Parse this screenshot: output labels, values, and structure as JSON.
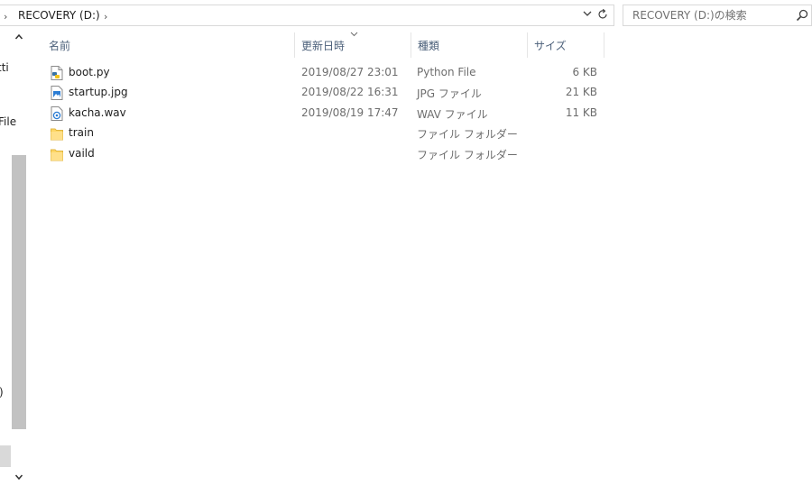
{
  "address_bar": {
    "path_label": "RECOVERY (D:)",
    "separator": "›",
    "dropdown_glyph": "⌄",
    "refresh_glyph": "↻"
  },
  "search": {
    "placeholder": "RECOVERY (D:)の検索",
    "value": ""
  },
  "nav_pane": {
    "fragments": [
      "tti",
      "File",
      ")"
    ],
    "scroll_up_glyph": "⌃",
    "scroll_down_glyph": "⌄"
  },
  "columns": {
    "name": "名前",
    "date": "更新日時",
    "type": "種類",
    "size": "サイズ",
    "sort_glyph": "⌄"
  },
  "files": [
    {
      "name": "boot.py",
      "icon": "python-file-icon",
      "date": "2019/08/27 23:01",
      "type": "Python File",
      "size": "6 KB"
    },
    {
      "name": "startup.jpg",
      "icon": "image-file-icon",
      "date": "2019/08/22 16:31",
      "type": "JPG ファイル",
      "size": "21 KB"
    },
    {
      "name": "kacha.wav",
      "icon": "audio-file-icon",
      "date": "2019/08/19 17:47",
      "type": "WAV ファイル",
      "size": "11 KB"
    },
    {
      "name": "train",
      "icon": "folder-icon",
      "date": "",
      "type": "ファイル フォルダー",
      "size": ""
    },
    {
      "name": "vaild",
      "icon": "folder-icon",
      "date": "",
      "type": "ファイル フォルダー",
      "size": ""
    }
  ],
  "colors": {
    "header_text": "#4c607a",
    "folder": "#ffd766",
    "secondary_text": "#6d6d6d"
  }
}
